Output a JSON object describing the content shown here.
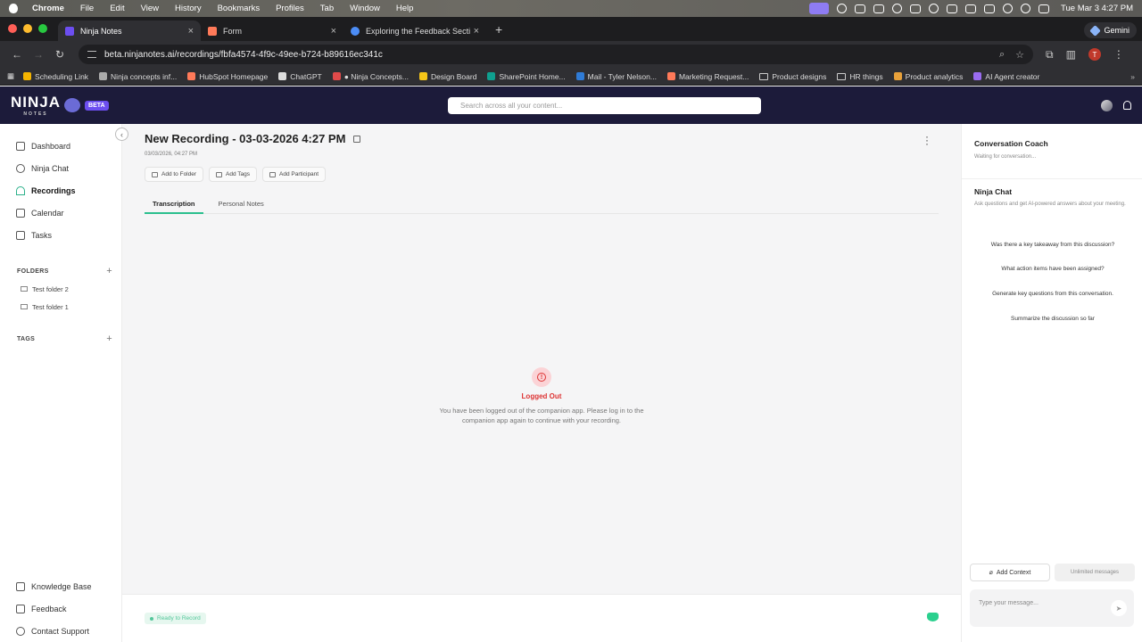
{
  "menubar": {
    "app": "Chrome",
    "items": [
      "File",
      "Edit",
      "View",
      "History",
      "Bookmarks",
      "Profiles",
      "Tab",
      "Window",
      "Help"
    ],
    "clock": "Tue Mar 3  4:27 PM"
  },
  "tabs": [
    {
      "title": "Ninja Notes",
      "active": true
    },
    {
      "title": "Form",
      "active": false
    },
    {
      "title": "Exploring the Feedback Secti",
      "active": false
    }
  ],
  "gemini_label": "Gemini",
  "url": "beta.ninjanotes.ai/recordings/fbfa4574-4f9c-49ee-b724-b89616ec341c",
  "profile_initial": "T",
  "bookmarks": [
    {
      "label": "Scheduling Link",
      "color": "#f5b400"
    },
    {
      "label": "Ninja concepts inf...",
      "color": "#aaaaaa"
    },
    {
      "label": "HubSpot Homepage",
      "color": "#ff7a59"
    },
    {
      "label": "ChatGPT",
      "color": "#dddddd"
    },
    {
      "label": "● Ninja Concepts...",
      "color": "#e04a4a"
    },
    {
      "label": "Design Board",
      "color": "#f5c518"
    },
    {
      "label": "SharePoint Home...",
      "color": "#0f9f8f"
    },
    {
      "label": "Mail - Tyler Nelson...",
      "color": "#2f7bd6"
    },
    {
      "label": "Marketing Request...",
      "color": "#ff7a59"
    },
    {
      "label": "Product designs",
      "color": "folder"
    },
    {
      "label": "HR things",
      "color": "folder"
    },
    {
      "label": "Product analytics",
      "color": "#e8a13a"
    },
    {
      "label": "AI Agent creator",
      "color": "#9a6cf0"
    }
  ],
  "header": {
    "logo": "NINJA",
    "logo_sub": "NOTES",
    "badge": "BETA",
    "search_placeholder": "Search across all your content..."
  },
  "sidebar": {
    "nav": [
      {
        "label": "Dashboard",
        "icon": "grid-icon"
      },
      {
        "label": "Ninja Chat",
        "icon": "chat-icon"
      },
      {
        "label": "Recordings",
        "icon": "headphones-icon",
        "active": true
      },
      {
        "label": "Calendar",
        "icon": "calendar-icon"
      },
      {
        "label": "Tasks",
        "icon": "tasks-icon"
      }
    ],
    "folders_heading": "FOLDERS",
    "folders": [
      "Test folder 2",
      "Test folder 1"
    ],
    "tags_heading": "TAGS",
    "bottom": [
      {
        "label": "Knowledge Base",
        "icon": "book-icon"
      },
      {
        "label": "Feedback",
        "icon": "feedback-icon"
      },
      {
        "label": "Contact Support",
        "icon": "support-icon"
      }
    ]
  },
  "recording": {
    "title": "New Recording - 03-03-2026 4:27 PM",
    "date": "03/03/2026, 04:27 PM",
    "actions": [
      "Add to Folder",
      "Add Tags",
      "Add Participant"
    ],
    "tabs": [
      "Transcription",
      "Personal Notes"
    ],
    "status_title": "Logged Out",
    "status_message": "You have been logged out of the companion app. Please log in to the companion app again to continue with your recording.",
    "ready_label": "Ready to Record"
  },
  "right_panel": {
    "coach_title": "Conversation Coach",
    "coach_sub": "Waiting for conversation...",
    "chat_title": "Ninja Chat",
    "chat_sub": "Ask questions and get AI-powered answers about your meeting.",
    "suggestions": [
      "Was there a key takeaway from this discussion?",
      "What action items have been assigned?",
      "Generate key questions from this conversation.",
      "Summarize the discussion so far"
    ],
    "add_context": "Add Context",
    "unlimited": "Unlimited messages",
    "message_placeholder": "Type your message..."
  },
  "colors": {
    "accent": "#2bbf8e",
    "header_bg": "#1c1b3a",
    "error": "#d33333"
  }
}
